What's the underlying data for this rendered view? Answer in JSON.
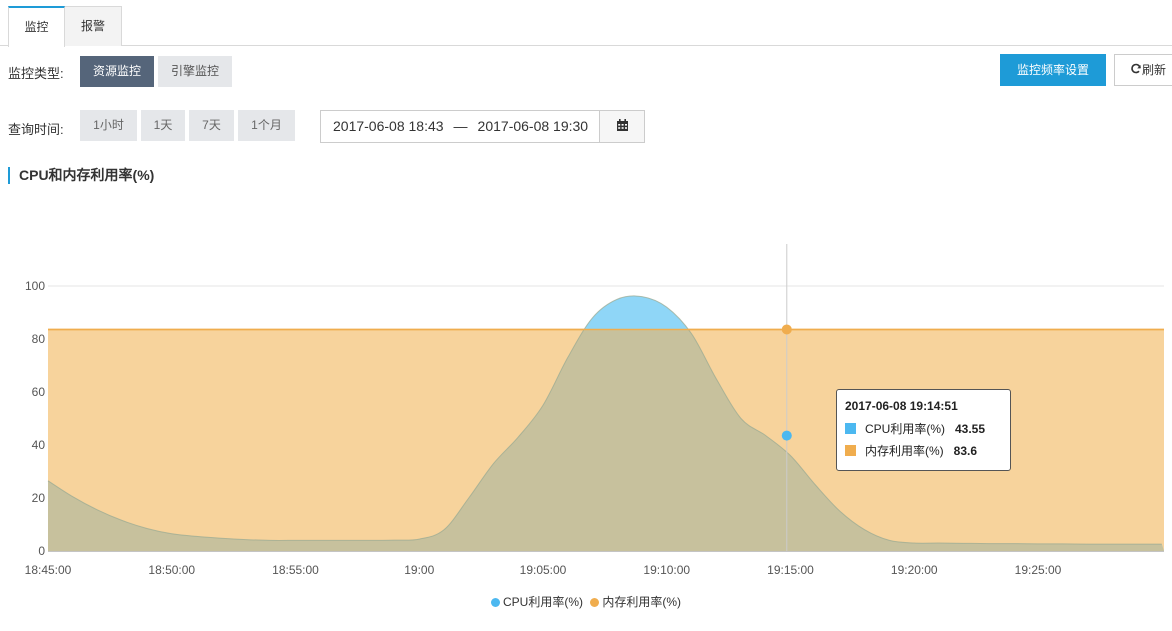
{
  "tabs": [
    {
      "label": "监控",
      "active": true
    },
    {
      "label": "报警",
      "active": false
    }
  ],
  "monitor_type": {
    "label": "监控类型:",
    "options": [
      "资源监控",
      "引擎监控"
    ],
    "selected": "资源监控"
  },
  "actions": {
    "frequency_settings": "监控频率设置",
    "refresh": "刷新"
  },
  "query_time": {
    "label": "查询时间:",
    "ranges": [
      "1小时",
      "1天",
      "7天",
      "1个月"
    ],
    "start": "2017-06-08 18:43",
    "separator": "—",
    "end": "2017-06-08 19:30"
  },
  "section_title": "CPU和内存利用率(%)",
  "colors": {
    "cpu": "#4cb8f0",
    "cpu_fill": "#8fd6f7",
    "memory": "#f0ad4e",
    "memory_fill": "#f7d39c",
    "overlap": "#c7c19d",
    "accent": "#1e9bd7"
  },
  "tooltip": {
    "time": "2017-06-08 19:14:51",
    "rows": [
      {
        "name": "CPU利用率(%)",
        "value": "43.55"
      },
      {
        "name": "内存利用率(%)",
        "value": "83.6"
      }
    ]
  },
  "chart_data": {
    "type": "area",
    "title": "CPU和内存利用率(%)",
    "x_ticks": [
      "18:45:00",
      "18:50:00",
      "18:55:00",
      "19:00",
      "19:05:00",
      "19:10:00",
      "19:15:00",
      "19:20:00",
      "19:25:00"
    ],
    "y_ticks": [
      0,
      20,
      40,
      60,
      80,
      100
    ],
    "ylim": [
      0,
      100
    ],
    "x_range_minutes": [
      0,
      45
    ],
    "grid": true,
    "legend_position": "bottom",
    "series": [
      {
        "name": "CPU利用率(%)",
        "x": [
          0,
          1,
          2,
          3,
          4,
          5,
          6,
          7,
          8,
          9,
          10,
          11,
          12,
          13,
          14,
          15,
          16,
          17,
          18,
          19,
          20,
          21,
          22,
          23,
          24,
          25,
          26,
          27,
          28,
          29,
          30,
          31,
          32,
          33,
          34,
          35,
          36,
          37,
          38,
          39,
          40,
          41,
          42,
          43,
          44,
          45
        ],
        "values": [
          26.5,
          20.5,
          15.5,
          11.5,
          8.5,
          6.5,
          5.5,
          4.8,
          4.3,
          4.0,
          4.0,
          4.0,
          4.0,
          4.0,
          4.1,
          4.5,
          8,
          20,
          33,
          43,
          55,
          73,
          88,
          95,
          96,
          92,
          82,
          65,
          50,
          43.55,
          36,
          25,
          15,
          8,
          4,
          3,
          3,
          2.9,
          2.8,
          2.8,
          2.7,
          2.7,
          2.6,
          2.6,
          2.6,
          2.6
        ]
      },
      {
        "name": "内存利用率(%)",
        "x": [
          0,
          45
        ],
        "values": [
          83.6,
          83.6
        ]
      }
    ],
    "highlight_x": 29.85
  }
}
